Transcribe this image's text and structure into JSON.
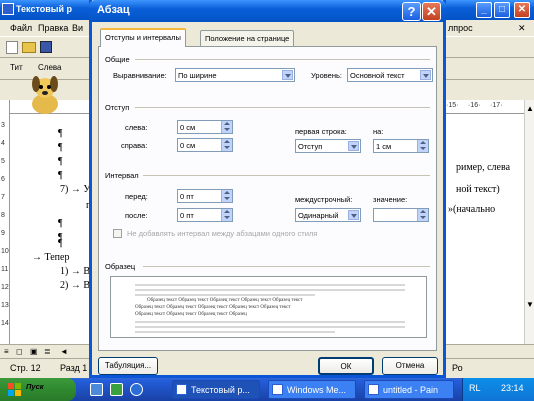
{
  "word": {
    "title": "Текстовый р",
    "menu": [
      "Файл",
      "Правка",
      "Ви"
    ],
    "menu_right": "лпрос",
    "toolbar2_left": "Тит",
    "toolbar2_b": "Слева",
    "ruler_marks": [
      "·15·",
      "·16·",
      "·17·"
    ],
    "vruler_marks": [
      "3",
      "4",
      "5",
      "6",
      "7",
      "8",
      "9",
      "10",
      "11",
      "12",
      "13",
      "14"
    ],
    "doc_lines_left": [
      "¶",
      "¶",
      "¶",
      "¶",
      "7) → У",
      "п",
      "¶",
      "¶",
      "¶",
      "→ Тепер",
      "1) → В",
      "2) → В"
    ],
    "doc_lines_right": [
      "ример, слева",
      "ной текст)",
      "»(начально"
    ],
    "status_page": "Стр. 12",
    "status_sec": "Разд 1",
    "status_lang": "Ро"
  },
  "dialog": {
    "title": "Абзац",
    "help_label": "?",
    "close_label": "✕",
    "tabs": [
      "Отступы и интервалы",
      "Положение на странице"
    ],
    "general": {
      "group": "Общие",
      "alignment_label": "Выравнивание:",
      "alignment_value": "По ширине",
      "level_label": "Уровень:",
      "level_value": "Основной текст"
    },
    "indent": {
      "group": "Отступ",
      "left_label": "слева:",
      "left_value": "0 см",
      "right_label": "справа:",
      "right_value": "0 см",
      "first_label": "первая строка:",
      "first_value": "Отступ",
      "by_label": "на:",
      "by_value": "1 см"
    },
    "spacing": {
      "group": "Интервал",
      "before_label": "перед:",
      "before_value": "0 пт",
      "after_label": "после:",
      "after_value": "0 пт",
      "line_label": "междустрочный:",
      "line_value": "Одинарный",
      "at_label": "значение:",
      "at_value": "",
      "no_space_label": "Не добавлять интервал между абзацами одного стиля"
    },
    "preview": {
      "group": "Образец",
      "sample_lines": [
        "Образец текст Образец текст Образец текст Образец текст Образец текст",
        "Образец текст Образец текст Образец текст Образец текст Образец текст",
        "Образец текст Образец текст Образец текст Образец"
      ]
    },
    "tabs_button": "Табуляция...",
    "ok_button": "ОК",
    "cancel_button": "Отмена"
  },
  "taskbar": {
    "start": "Пуск",
    "tasks": [
      "Текстовый р...",
      "Windows Me...",
      "untitled - Pain"
    ],
    "tray_lang": "RL",
    "clock": "23:14"
  },
  "colors": {
    "titlebar": "#0a5fd8",
    "taskbar": "#245edb",
    "start": "#2f8a2f",
    "dialog_bg": "#ece9d8",
    "tab_accent": "#f4b83c"
  }
}
